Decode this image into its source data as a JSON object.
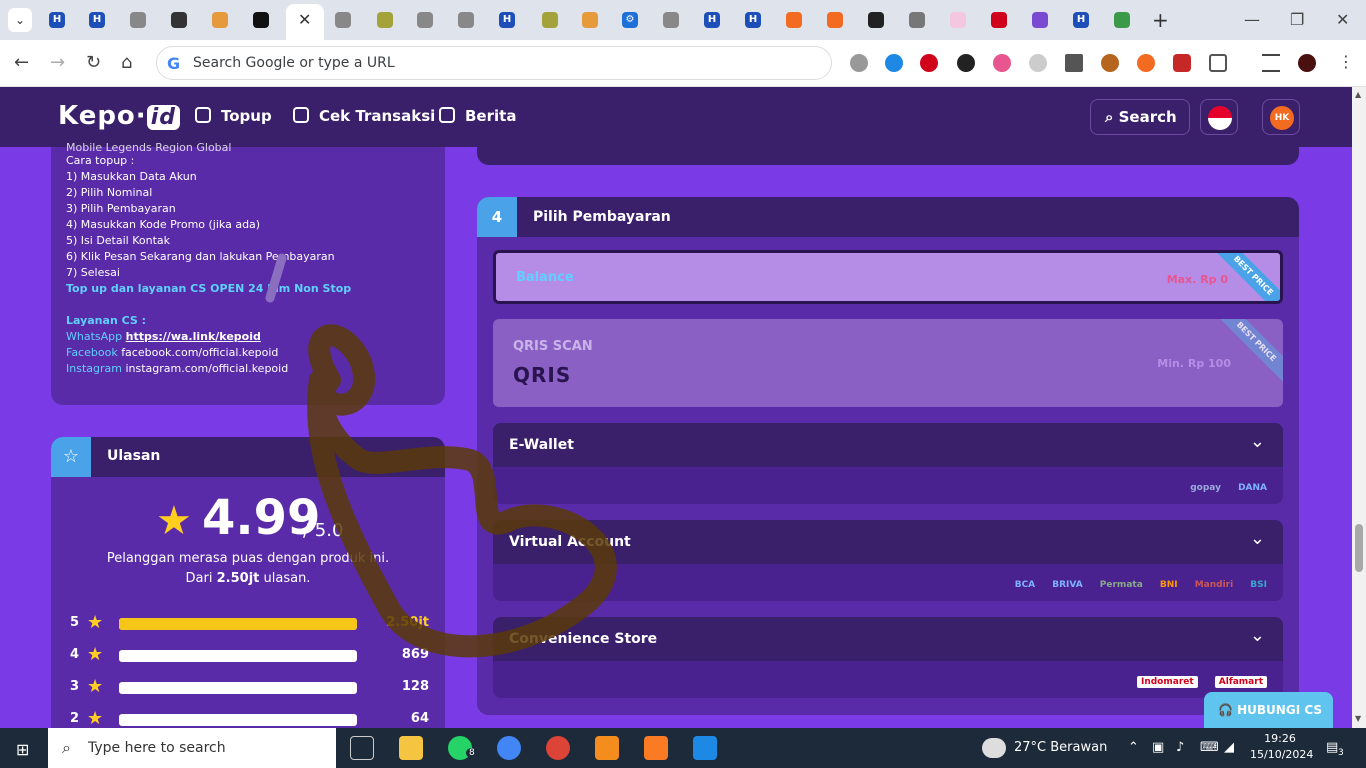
{
  "browser": {
    "tab_close_glyph": "✕",
    "new_tab_glyph": "+",
    "window_controls": [
      "—",
      "❐",
      "✕"
    ],
    "nav": {
      "back": "←",
      "forward": "→",
      "reload": "↻",
      "home": "⌂"
    },
    "omnibox": {
      "placeholder": "Search Google or type a URL",
      "g": "G"
    }
  },
  "header": {
    "logo_main": "Kepo·",
    "logo_id": "id",
    "nav": [
      {
        "label": "Topup"
      },
      {
        "label": "Cek Transaksi"
      },
      {
        "label": "Berita"
      }
    ],
    "search_label": "Search",
    "avatar_initials": "HK"
  },
  "info": {
    "lines": [
      "Mobile Legends Region Global",
      "Cara topup :",
      "1) Masukkan Data Akun",
      "2) Pilih Nominal",
      "3) Pilih Pembayaran",
      "4) Masukkan Kode Promo (jika ada)",
      "5) Isi Detail Kontak",
      "6) Klik Pesan Sekarang dan lakukan Pembayaran",
      "7) Selesai"
    ],
    "open_text": "Top up dan layanan CS OPEN 24 Jam Non Stop",
    "cs_title": "Layanan CS :",
    "contacts": [
      {
        "key": "WhatsApp",
        "value": "https://wa.link/kepoid"
      },
      {
        "key": "Facebook",
        "value": "facebook.com/official.kepoid"
      },
      {
        "key": "Instagram",
        "value": "instagram.com/official.kepoid"
      }
    ]
  },
  "reviews": {
    "title": "Ulasan",
    "score": "4.99",
    "score_max": "/ 5.0",
    "line1": "Pelanggan merasa puas dengan produk ini.",
    "line2_prefix": "Dari ",
    "line2_count": "2.50jt",
    "line2_suffix": " ulasan.",
    "rows": [
      {
        "stars": "5",
        "count": "2.50jt",
        "fraction": 1.0
      },
      {
        "stars": "4",
        "count": "869",
        "fraction": 0.0
      },
      {
        "stars": "3",
        "count": "128",
        "fraction": 0.0
      },
      {
        "stars": "2",
        "count": "64",
        "fraction": 0.0
      }
    ]
  },
  "payment": {
    "step": "4",
    "title": "Pilih Pembayaran",
    "balance": {
      "name": "Balance",
      "price": "Max. Rp  0",
      "ribbon": "BEST PRICE"
    },
    "qris": {
      "name": "QRIS SCAN",
      "logo": "QRIS",
      "price": "Min. Rp  100",
      "ribbon": "BEST PRICE"
    },
    "groups": [
      {
        "title": "E-Wallet",
        "logos": [
          "gopay",
          "DANA"
        ]
      },
      {
        "title": "Virtual Account",
        "logos": [
          "BCA",
          "BRIVA",
          "Permata",
          "BNI",
          "Mandiri",
          "BSI"
        ]
      },
      {
        "title": "Convenience Store",
        "logos": [
          "Indomaret",
          "Alfamart"
        ]
      }
    ],
    "cs_button": "HUBUNGI CS"
  },
  "taskbar": {
    "search_placeholder": "Type here to search",
    "weather": "27°C  Berawan",
    "time": "19:26",
    "date": "15/10/2024",
    "notif_count": "3",
    "whatsapp_badge": "8"
  },
  "colors": {
    "page_bg": "#7a3be6",
    "header_bg": "#3a1f6b",
    "card_bg": "#5a2ba8",
    "accent_blue": "#4aa3e8",
    "star_yellow": "#ffce1f"
  }
}
